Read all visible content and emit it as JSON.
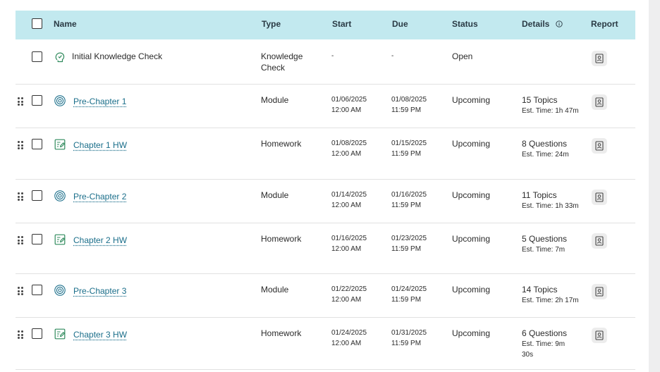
{
  "headers": {
    "name": "Name",
    "type": "Type",
    "start": "Start",
    "due": "Due",
    "status": "Status",
    "details": "Details",
    "report": "Report"
  },
  "rows": [
    {
      "name": "Initial Knowledge Check",
      "type_line1": "Knowledge",
      "type_line2": "Check",
      "start_date": "-",
      "start_time": "",
      "due_date": "-",
      "due_time": "",
      "status": "Open",
      "detail_main": "",
      "detail_sub": "",
      "detail_sub2": "",
      "icon": "knowledge-check-icon",
      "link": false
    },
    {
      "name": "Pre-Chapter 1",
      "type_line1": "Module",
      "type_line2": "",
      "start_date": "01/06/2025",
      "start_time": "12:00 AM",
      "due_date": "01/08/2025",
      "due_time": "11:59 PM",
      "status": "Upcoming",
      "detail_main": "15 Topics",
      "detail_sub": "Est. Time: 1h 47m",
      "detail_sub2": "",
      "icon": "target-icon",
      "link": true
    },
    {
      "name": "Chapter 1 HW",
      "type_line1": "Homework",
      "type_line2": "",
      "start_date": "01/08/2025",
      "start_time": "12:00 AM",
      "due_date": "01/15/2025",
      "due_time": "11:59 PM",
      "status": "Upcoming",
      "detail_main": "8 Questions",
      "detail_sub": "Est. Time: 24m",
      "detail_sub2": "",
      "icon": "homework-icon",
      "link": true
    },
    {
      "name": "Pre-Chapter 2",
      "type_line1": "Module",
      "type_line2": "",
      "start_date": "01/14/2025",
      "start_time": "12:00 AM",
      "due_date": "01/16/2025",
      "due_time": "11:59 PM",
      "status": "Upcoming",
      "detail_main": "11 Topics",
      "detail_sub": "Est. Time: 1h 33m",
      "detail_sub2": "",
      "icon": "target-icon",
      "link": true
    },
    {
      "name": "Chapter 2 HW",
      "type_line1": "Homework",
      "type_line2": "",
      "start_date": "01/16/2025",
      "start_time": "12:00 AM",
      "due_date": "01/23/2025",
      "due_time": "11:59 PM",
      "status": "Upcoming",
      "detail_main": "5 Questions",
      "detail_sub": "Est. Time: 7m",
      "detail_sub2": "",
      "icon": "homework-icon",
      "link": true
    },
    {
      "name": "Pre-Chapter 3",
      "type_line1": "Module",
      "type_line2": "",
      "start_date": "01/22/2025",
      "start_time": "12:00 AM",
      "due_date": "01/24/2025",
      "due_time": "11:59 PM",
      "status": "Upcoming",
      "detail_main": "14 Topics",
      "detail_sub": "Est. Time: 2h 17m",
      "detail_sub2": "",
      "icon": "target-icon",
      "link": true
    },
    {
      "name": "Chapter 3 HW",
      "type_line1": "Homework",
      "type_line2": "",
      "start_date": "01/24/2025",
      "start_time": "12:00 AM",
      "due_date": "01/31/2025",
      "due_time": "11:59 PM",
      "status": "Upcoming",
      "detail_main": "6 Questions",
      "detail_sub": "Est. Time: 9m",
      "detail_sub2": "30s",
      "icon": "homework-icon",
      "link": true
    }
  ],
  "colors": {
    "header_bg": "#c2e9ef",
    "link": "#1a6e8a",
    "icon_green": "#2f8a5c"
  }
}
